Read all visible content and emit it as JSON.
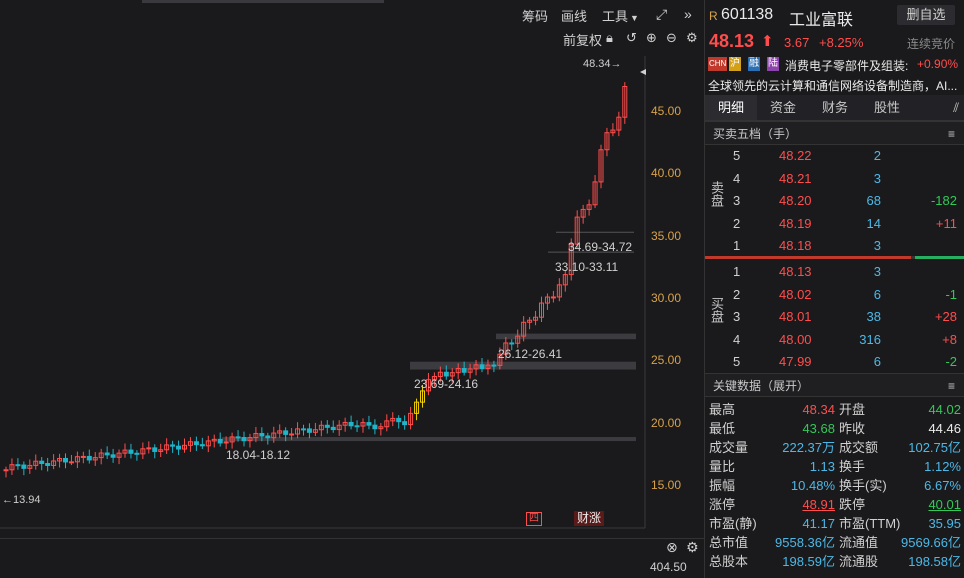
{
  "toolbar": {
    "chip_label": "筹码",
    "draw_label": "画线",
    "tools_label": "工具",
    "restore_label": "前复权"
  },
  "chart": {
    "price_labels": [
      "45.00",
      "40.00",
      "35.00",
      "30.00",
      "25.00",
      "20.00",
      "15.00"
    ],
    "annotations": {
      "high_marker": "48.34",
      "low_marker": "13.94",
      "gap1": "34.69-34.72",
      "gap2": "33.10-33.11",
      "gap3": "26.12-26.41",
      "gap4": "23.69-24.16",
      "gap5": "18.04-18.12"
    },
    "badges": {
      "report": "四",
      "finance": "财涨"
    },
    "volume_value": "404.50"
  },
  "stock": {
    "prefix": "R",
    "code": "601138",
    "name": "工业富联",
    "watch_button": "删自选",
    "price": "48.13",
    "change": "3.67",
    "change_pct": "+8.25%",
    "auction_label": "连续竞价",
    "tags": [
      "CHN",
      "沪",
      "融",
      "陆"
    ],
    "sector_text": "消费电子零部件及组装:",
    "sector_change": "+0.90%",
    "desc": "全球领先的云计算和通信网络设备制造商，AI..."
  },
  "tabs": [
    "明细",
    "资金",
    "财务",
    "股性"
  ],
  "orderbook": {
    "title": "买卖五档（手）",
    "sell_label": "卖盘",
    "buy_label": "买盘",
    "sell": [
      {
        "level": "5",
        "price": "48.22",
        "vol": "2",
        "delta": ""
      },
      {
        "level": "4",
        "price": "48.21",
        "vol": "3",
        "delta": ""
      },
      {
        "level": "3",
        "price": "48.20",
        "vol": "68",
        "delta": "-182"
      },
      {
        "level": "2",
        "price": "48.19",
        "vol": "14",
        "delta": "+11"
      },
      {
        "level": "1",
        "price": "48.18",
        "vol": "3",
        "delta": ""
      }
    ],
    "buy": [
      {
        "level": "1",
        "price": "48.13",
        "vol": "3",
        "delta": ""
      },
      {
        "level": "2",
        "price": "48.02",
        "vol": "6",
        "delta": "-1"
      },
      {
        "level": "3",
        "price": "48.01",
        "vol": "38",
        "delta": "+28"
      },
      {
        "level": "4",
        "price": "48.00",
        "vol": "316",
        "delta": "+8"
      },
      {
        "level": "5",
        "price": "47.99",
        "vol": "6",
        "delta": "-2"
      }
    ]
  },
  "key_data": {
    "title": "关键数据（展开）",
    "rows": [
      {
        "l1": "最高",
        "v1": "48.34",
        "c1": "red",
        "l2": "开盘",
        "v2": "44.02",
        "c2": "green"
      },
      {
        "l1": "最低",
        "v1": "43.68",
        "c1": "green",
        "l2": "昨收",
        "v2": "44.46",
        "c2": "white"
      },
      {
        "l1": "成交量",
        "v1": "222.37万",
        "c1": "blue",
        "l2": "成交额",
        "v2": "102.75亿",
        "c2": "blue"
      },
      {
        "l1": "量比",
        "v1": "1.13",
        "c1": "blue",
        "l2": "换手",
        "v2": "1.12%",
        "c2": "blue"
      },
      {
        "l1": "振幅",
        "v1": "10.48%",
        "c1": "blue",
        "l2": "换手(实)",
        "v2": "6.67%",
        "c2": "blue"
      },
      {
        "l1": "涨停",
        "v1": "48.91",
        "c1": "red",
        "l2": "跌停",
        "v2": "40.01",
        "c2": "green"
      },
      {
        "l1": "市盈(静)",
        "v1": "41.17",
        "c1": "blue",
        "l2": "市盈(TTM)",
        "v2": "35.95",
        "c2": "blue"
      },
      {
        "l1": "总市值",
        "v1": "9558.36亿",
        "c1": "blue",
        "l2": "流通值",
        "v2": "9569.66亿",
        "c2": "blue"
      },
      {
        "l1": "总股本",
        "v1": "198.59亿",
        "c1": "blue",
        "l2": "流通股",
        "v2": "198.58亿",
        "c2": "blue"
      }
    ]
  },
  "colors": {
    "up": "#ff4d4d",
    "down": "#34c759",
    "cyan": "#1fb5c9",
    "bg": "#1a1a1c"
  }
}
